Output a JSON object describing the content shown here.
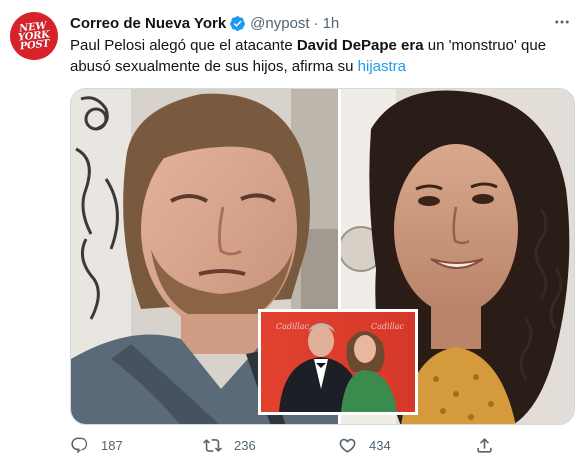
{
  "account": {
    "logo_lines": [
      "NEW",
      "YORK",
      "POST"
    ],
    "name": "Correo de Nueva York",
    "handle": "@nypost",
    "separator": "·",
    "time": "1h",
    "verified_icon": "verified-badge-icon"
  },
  "tweet": {
    "text_part1": "Paul Pelosi alegó que el atacante ",
    "text_bold1": "David DePape era",
    "text_part2": " un 'monstruo' que abusó sexualmente de sus hijos, afirma su ",
    "hashtag": "hijastra"
  },
  "media": {
    "inset_sign_text": "Cadillac"
  },
  "actions": {
    "reply_count": "187",
    "retweet_count": "236",
    "like_count": "434"
  },
  "colors": {
    "brand_red": "#d8222a",
    "verified_blue": "#1d9bf0",
    "secondary_text": "#536471"
  }
}
